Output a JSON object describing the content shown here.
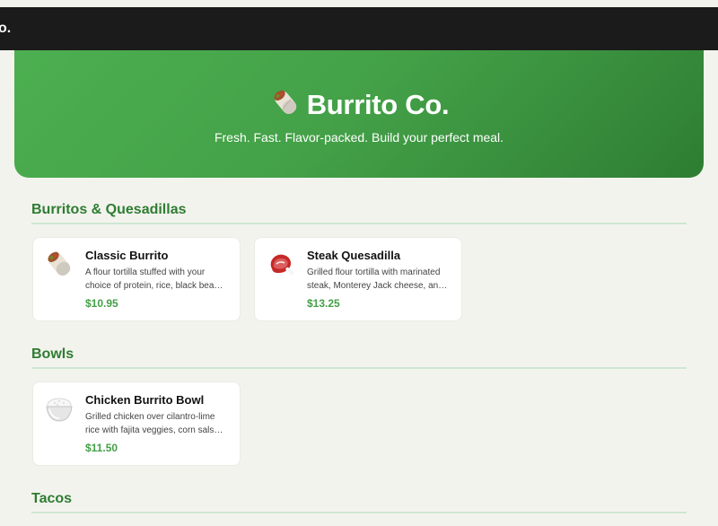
{
  "topbar": {
    "brand_fragment": "o."
  },
  "hero": {
    "title": "Burrito Co.",
    "subtitle": "Fresh. Fast. Flavor-packed. Build your perfect meal.",
    "icon": "burrito-icon"
  },
  "sections": [
    {
      "title": "Burritos & Quesadillas",
      "items": [
        {
          "name": "Classic Burrito",
          "description": "A flour tortilla stuffed with your choice of protein, rice, black beans, cheese and salsa.",
          "price": "$10.95",
          "icon": "burrito-icon"
        },
        {
          "name": "Steak Quesadilla",
          "description": "Grilled flour tortilla with marinated steak, Monterey Jack cheese, and peppers.",
          "price": "$13.25",
          "icon": "steak-icon"
        }
      ]
    },
    {
      "title": "Bowls",
      "items": [
        {
          "name": "Chicken Burrito Bowl",
          "description": "Grilled chicken over cilantro-lime rice with fajita veggies, corn salsa and cheese.",
          "price": "$11.50",
          "icon": "rice-bowl-icon"
        }
      ]
    },
    {
      "title": "Tacos",
      "items": []
    }
  ],
  "colors": {
    "accent": "#43a047",
    "section_title": "#2e7d32",
    "hero_start": "#4caf50",
    "hero_end": "#2e7d32",
    "background": "#f3f3ee"
  }
}
